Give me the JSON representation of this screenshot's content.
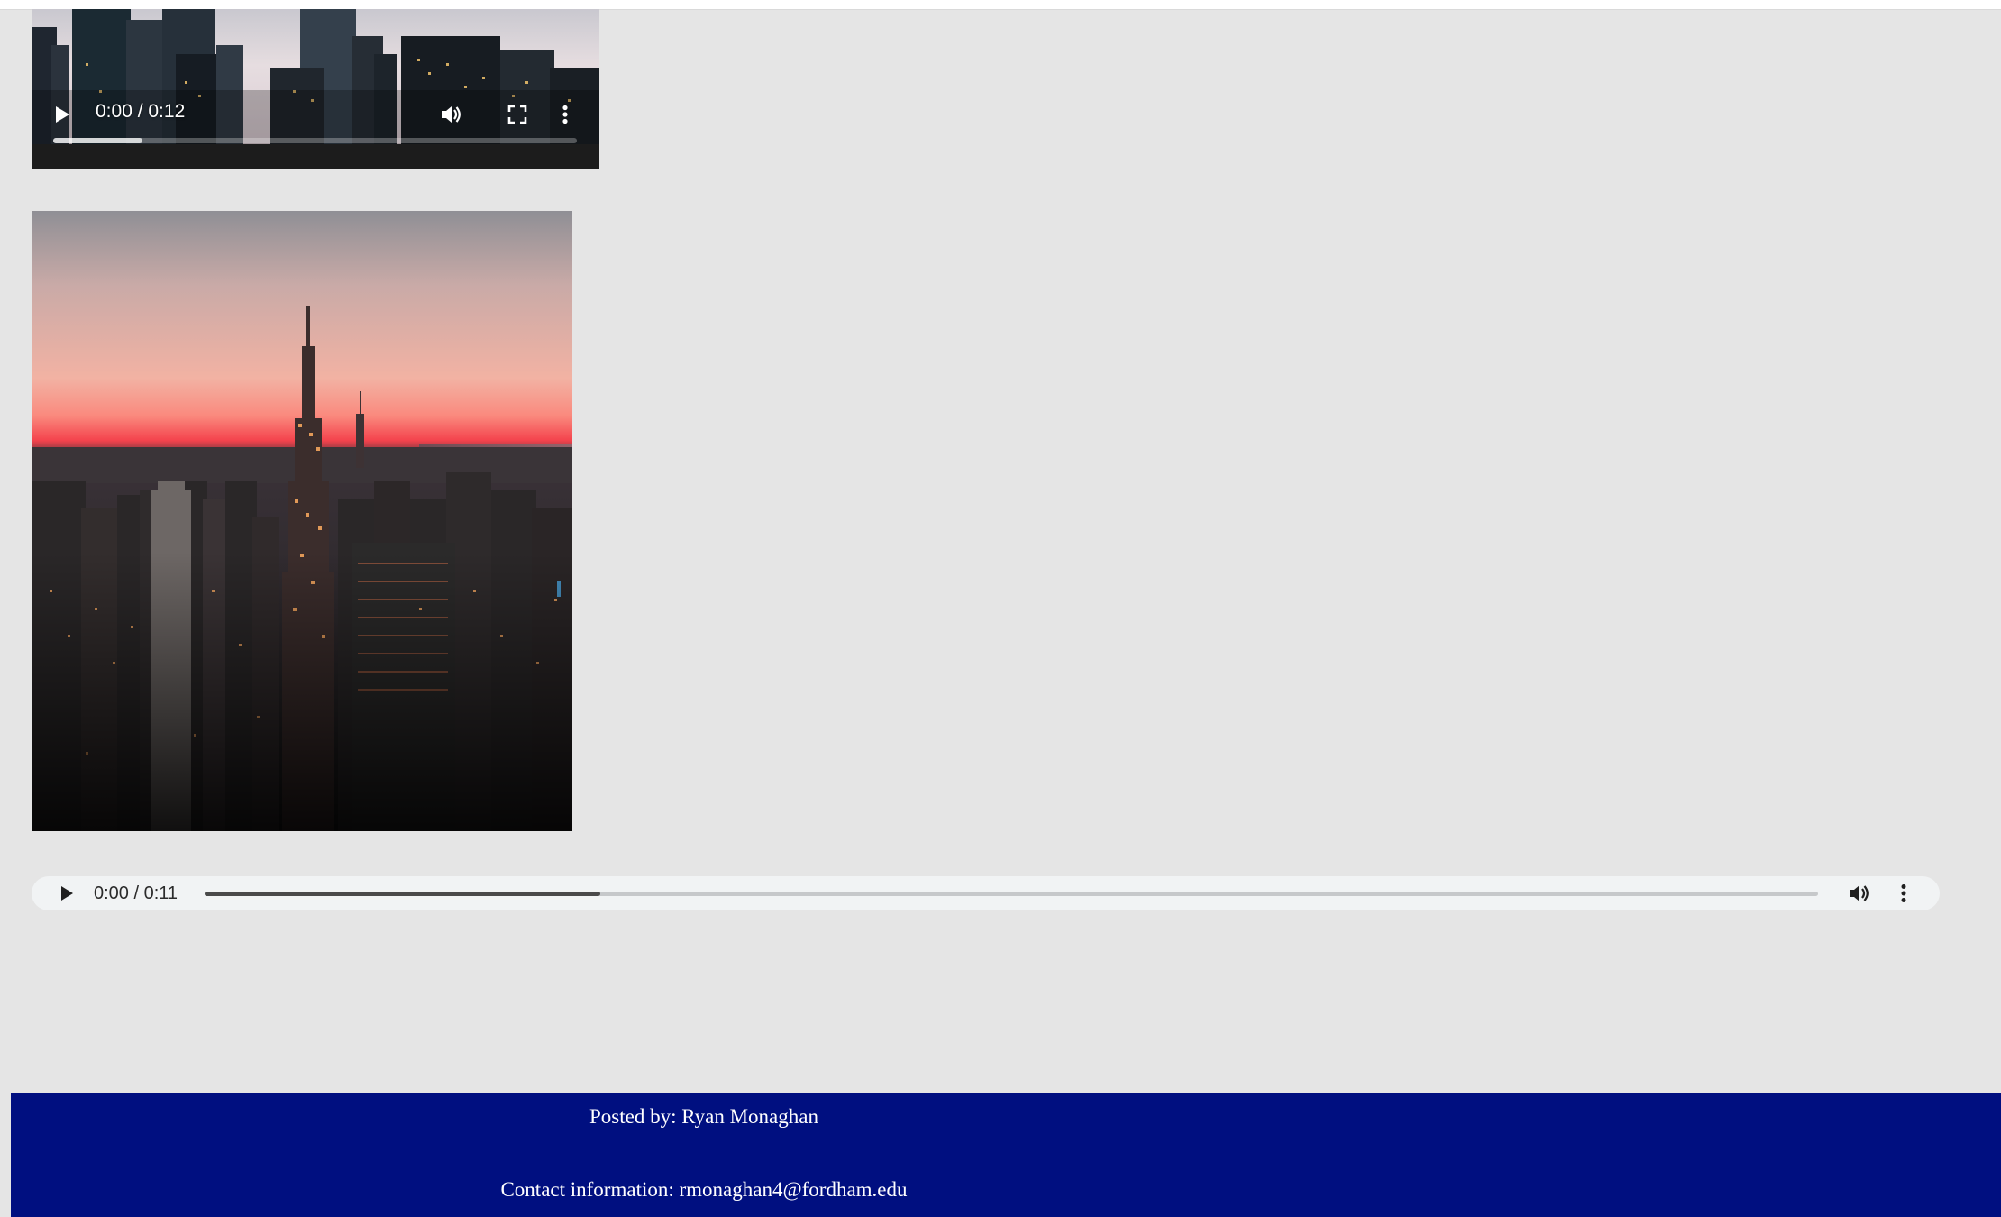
{
  "video": {
    "time_display": "0:00 / 0:12",
    "progress_fraction": 0.17,
    "icons": {
      "play": "play-icon",
      "volume": "volume-icon",
      "fullscreen": "fullscreen-icon",
      "more": "more-options-icon"
    }
  },
  "image": {
    "subject": "city skyline at sunset"
  },
  "audio": {
    "time_display": "0:00 / 0:11",
    "progress_fraction": 0.245,
    "icons": {
      "play": "play-icon",
      "volume": "volume-icon",
      "more": "more-options-icon"
    }
  },
  "footer": {
    "posted_by": "Posted by: Ryan Monaghan",
    "contact_prefix": "Contact information: ",
    "contact_email": "rmonaghan4@fordham.edu"
  },
  "colors": {
    "page_background": "#e5e5e5",
    "footer_background": "#000f80",
    "footer_text": "#ffffff",
    "audio_background": "#f1f3f4"
  }
}
